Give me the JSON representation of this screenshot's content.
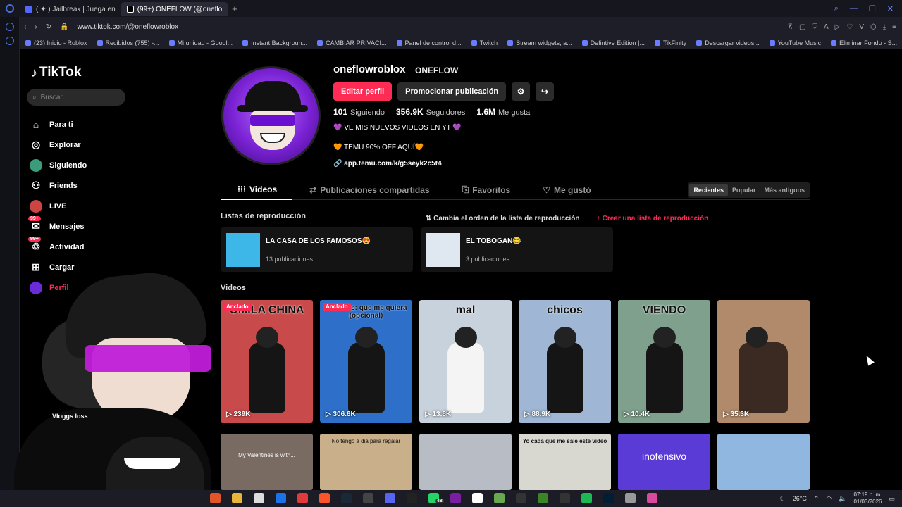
{
  "browser": {
    "tabs": [
      {
        "label": "( ✦ ) Jailbreak | Juega en"
      },
      {
        "label": "(99+) ONEFLOW (@oneflo"
      }
    ],
    "url": "www.tiktok.com/@oneflowroblox",
    "bookmarks": [
      "(23) Inicio - Roblox",
      "Recibidos (755) -...",
      "Mi unidad - Googl...",
      "Instant Backgroun...",
      "CAMBIAR PRIVACI...",
      "Panel de control d...",
      "Twitch",
      "Stream widgets, a...",
      "Defintive Edition |...",
      "TikFinity",
      "Descargar videos...",
      "YouTube Music",
      "Eliminar Fondo - S..."
    ]
  },
  "sidebar": {
    "logo": "TikTok",
    "search_placeholder": "Buscar",
    "items": [
      {
        "label": "Para ti",
        "icon": "home-icon"
      },
      {
        "label": "Explorar",
        "icon": "compass-icon"
      },
      {
        "label": "Siguiendo",
        "icon": "following-icon"
      },
      {
        "label": "Friends",
        "icon": "friends-icon"
      },
      {
        "label": "LIVE",
        "icon": "live-icon"
      },
      {
        "label": "Mensajes",
        "icon": "messages-icon",
        "badge": "99+"
      },
      {
        "label": "Actividad",
        "icon": "activity-icon",
        "badge": "99+"
      },
      {
        "label": "Cargar",
        "icon": "upload-icon"
      },
      {
        "label": "Perfil",
        "icon": "profile-icon"
      }
    ]
  },
  "profile": {
    "username": "oneflowroblox",
    "nickname": "ONEFLOW",
    "edit_button": "Editar perfil",
    "promote_button": "Promocionar publicación",
    "following_count": "101",
    "following_label": "Siguiendo",
    "followers_count": "356.9K",
    "followers_label": "Seguidores",
    "likes_count": "1.6M",
    "likes_label": "Me gusta",
    "bio_line1": "💜 VE MIS NUEVOS VIDEOS EN YT 💜",
    "bio_line2": "🧡 TEMU 90% OFF AQUÍ🧡",
    "link": "app.temu.com/k/g5seyk2c5t4"
  },
  "tabs": {
    "videos": "Videos",
    "shared": "Publicaciones compartidas",
    "favorites": "Favoritos",
    "liked": "Me gustó",
    "sort": [
      "Recientes",
      "Popular",
      "Más antiguos"
    ]
  },
  "playlists": {
    "heading": "Listas de reproducción",
    "reorder": "Cambia el orden de la lista de reproducción",
    "create": "Crear una lista de reproducción",
    "items": [
      {
        "title": "LA CASA DE LOS FAMOSOS😍",
        "count": "13 publicaciones"
      },
      {
        "title": "EL TOBOGAN😂",
        "count": "3 publicaciones"
      }
    ]
  },
  "videos": {
    "heading": "Videos",
    "pinned_label": "Anclado",
    "items": [
      {
        "caption": "OMILA CHINA",
        "views": "239K",
        "bg": "#c94a4a",
        "pinned": true
      },
      {
        "caption": "hombres: que me quiera (opcional)",
        "views": "306.6K",
        "bg": "#2d6fc9",
        "pinned": true
      },
      {
        "caption": "mal",
        "views": "13.8K",
        "bg": "#c8d2dc",
        "pinned": false
      },
      {
        "caption": "chicos",
        "views": "88.9K",
        "bg": "#9fb7d4",
        "pinned": false
      },
      {
        "caption": "VIENDO",
        "views": "10.4K",
        "bg": "#7fa08c",
        "pinned": false
      },
      {
        "caption": "",
        "views": "35.3K",
        "bg": "#b08a6a",
        "pinned": false
      }
    ],
    "row2": [
      {
        "caption": "My Valentines is with...",
        "bg": "#7a6b62"
      },
      {
        "caption": "No tengo a dia para regalar",
        "bg": "#c9b08a"
      },
      {
        "caption": "",
        "bg": "#b8bcc4"
      },
      {
        "caption": "Yo cada que me sale este video",
        "bg": "#d8d8d0"
      },
      {
        "caption": "inofensivo",
        "bg": "#5b3bd6"
      },
      {
        "caption": "",
        "bg": "#8fb7e0"
      }
    ]
  },
  "overlay": {
    "label": "Vloggs loss"
  },
  "taskbar": {
    "temperature": "26°C",
    "time": "07:19 p. m.",
    "date": "01/03/2026",
    "notifications": "48"
  },
  "colors": {
    "accent": "#fe2c55",
    "bg": "#000000"
  }
}
